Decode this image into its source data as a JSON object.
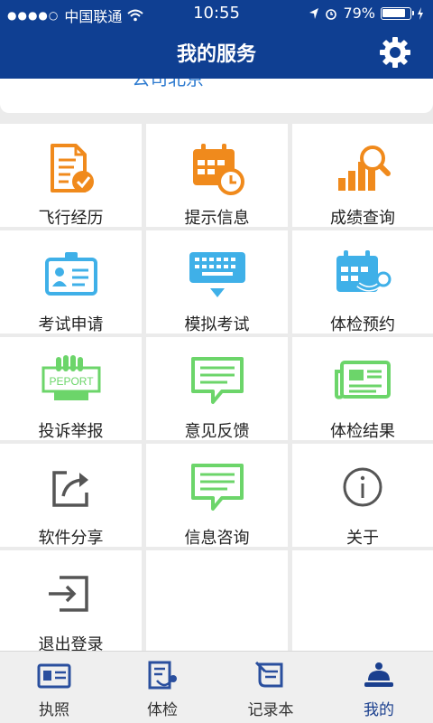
{
  "status": {
    "signal": "●●●●○",
    "carrier": "中国联通",
    "time": "10:55",
    "battery": "79%"
  },
  "header": {
    "title": "我的服务"
  },
  "top_card": {
    "partial_text": "公司北京"
  },
  "grid_items": [
    {
      "label": "飞行经历",
      "icon": "flight-log-icon",
      "color": "#f08a1c"
    },
    {
      "label": "提示信息",
      "icon": "calendar-clock-icon",
      "color": "#f08a1c"
    },
    {
      "label": "成绩查询",
      "icon": "score-search-icon",
      "color": "#f08a1c"
    },
    {
      "label": "考试申请",
      "icon": "id-card-icon",
      "color": "#3fb0e8"
    },
    {
      "label": "模拟考试",
      "icon": "keyboard-icon",
      "color": "#3fb0e8"
    },
    {
      "label": "体检预约",
      "icon": "stethoscope-calendar-icon",
      "color": "#3fb0e8"
    },
    {
      "label": "投诉举报",
      "icon": "report-icon",
      "color": "#6cd56a",
      "icon_text": "PEPORT"
    },
    {
      "label": "意见反馈",
      "icon": "feedback-icon",
      "color": "#6cd56a"
    },
    {
      "label": "体检结果",
      "icon": "newspaper-icon",
      "color": "#6cd56a"
    },
    {
      "label": "软件分享",
      "icon": "share-icon",
      "color": "#555555"
    },
    {
      "label": "信息咨询",
      "icon": "chat-icon",
      "color": "#6cd56a"
    },
    {
      "label": "关于",
      "icon": "info-icon",
      "color": "#555555"
    },
    {
      "label": "退出登录",
      "icon": "logout-icon",
      "color": "#555555"
    }
  ],
  "tabs": [
    {
      "label": "执照",
      "icon": "license-icon",
      "active": false
    },
    {
      "label": "体检",
      "icon": "medical-icon",
      "active": false
    },
    {
      "label": "记录本",
      "icon": "logbook-icon",
      "active": false
    },
    {
      "label": "我的",
      "icon": "user-service-icon",
      "active": true
    }
  ],
  "colors": {
    "brand": "#0f3f92",
    "active_tab": "#1a3f8e",
    "tab_icon": "#2a4f9e"
  }
}
